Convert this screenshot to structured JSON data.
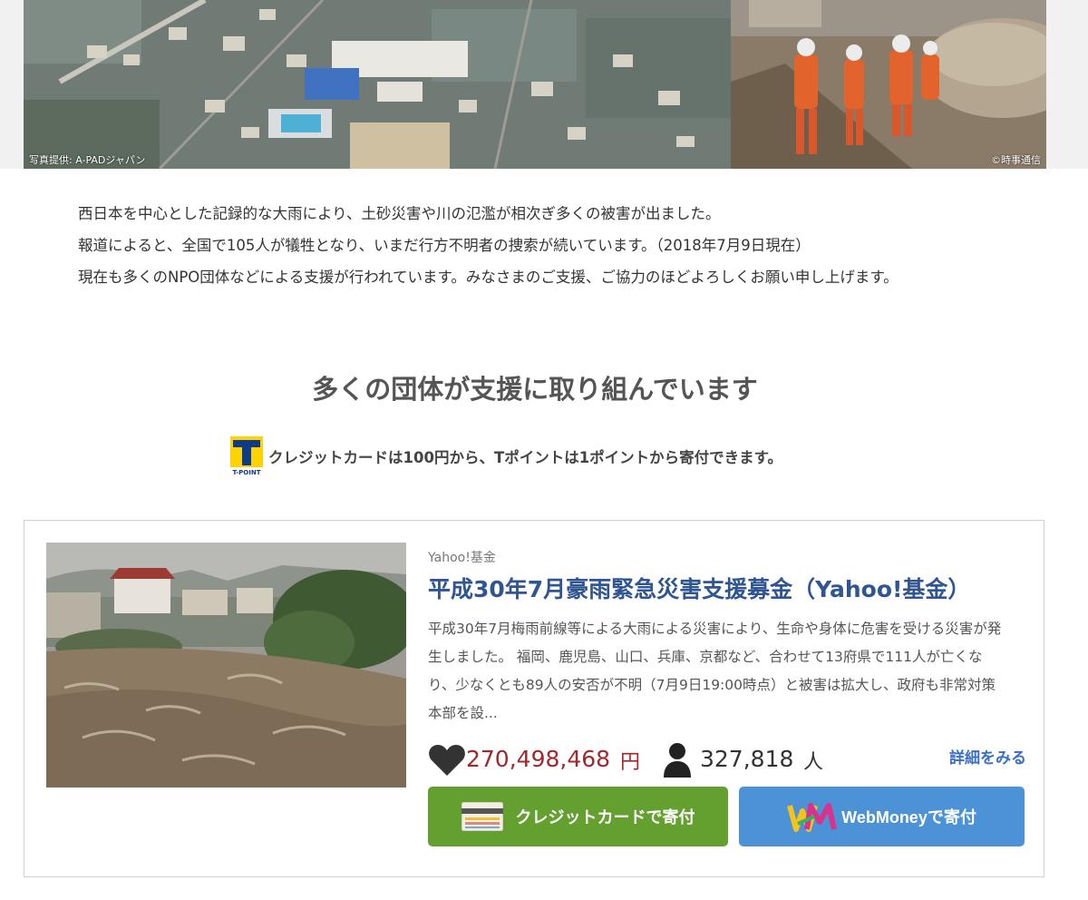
{
  "hero": {
    "credit_left": "写真提供: A-PADジャパン",
    "credit_right": "©時事通信"
  },
  "intro": {
    "line1": "西日本を中心とした記録的な大雨により、土砂災害や川の氾濫が相次ぎ多くの被害が出ました。",
    "line2": "報道によると、全国で105人が犠牲となり、いまだ行方不明者の捜索が続いています。（2018年7月9日現在）",
    "line3": "現在も多くのNPO団体などによる支援が行われています。みなさまのご支援、ご協力のほどよろしくお願い申し上げます。"
  },
  "section": {
    "heading": "多くの団体が支援に取り組んでいます",
    "tpoint_logo_text": "T-POINT",
    "tpoint_note": "クレジットカードは100円から、Tポイントは1ポイントから寄付できます。"
  },
  "fund": {
    "org": "Yahoo!基金",
    "title": "平成30年7月豪雨緊急災害支援募金（Yahoo!基金）",
    "description": "平成30年7月梅雨前線等による大雨による災害により、生命や身体に危害を受ける災害が発生しました。 福岡、鹿児島、山口、兵庫、京都など、合わせて13府県で111人が亡くなり、少なくとも89人の安否が不明（7月9日19:00時点）と被害は拡大し、政府も非常対策本部を設...",
    "amount": "270,498,468",
    "amount_unit": "円",
    "supporters": "327,818",
    "supporters_unit": "人",
    "details_label": "詳細をみる",
    "credit_button": "クレジットカードで寄付",
    "webmoney_button": "WebMoneyで寄付"
  },
  "colors": {
    "title_blue": "#2f5592",
    "amount_red": "#a3282c",
    "credit_green": "#64a030",
    "webmoney_blue": "#4b92d6",
    "link_blue": "#3a6fc9"
  },
  "icons": [
    "tpoint-logo",
    "heart-icon",
    "person-icon",
    "credit-card-icon",
    "webmoney-logo"
  ]
}
